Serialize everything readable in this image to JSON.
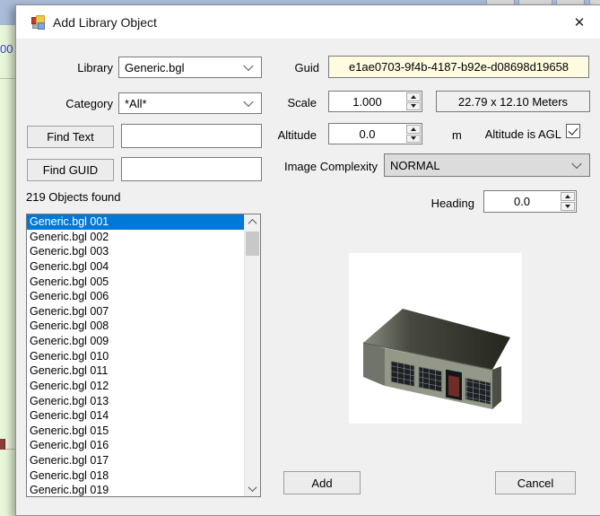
{
  "window": {
    "title": "Add Library Object",
    "close_glyph": "✕"
  },
  "background": {
    "partial_text": "00"
  },
  "colors": {
    "selection": "#0078d7",
    "guid_field_bg": "#fffbe1",
    "dialog_bg": "#f0f0f0",
    "titlebar_bg": "#ffffff",
    "top_strip": "#a9bcd9",
    "desktop_green": "#e8f7da"
  },
  "form": {
    "library_label": "Library",
    "library_value": "Generic.bgl",
    "category_label": "Category",
    "category_value": "*All*",
    "guid_label": "Guid",
    "guid_value": "e1ae0703-9f4b-4187-b92e-d08698d19658",
    "scale_label": "Scale",
    "scale_value": "1.000",
    "size_value": "22.79 x 12.10 Meters",
    "find_text_label": "Find Text",
    "find_text_value": "",
    "find_guid_label": "Find GUID",
    "find_guid_value": "",
    "altitude_label": "Altitude",
    "altitude_value": "0.0",
    "altitude_unit": "m",
    "agl_label": "Altitude is AGL",
    "agl_checked": true,
    "image_complexity_label": "Image Complexity",
    "image_complexity_value": "NORMAL",
    "heading_label": "Heading",
    "heading_value": "0.0",
    "objects_found": "219 Objects found",
    "add_label": "Add",
    "cancel_label": "Cancel"
  },
  "object_list": {
    "selected_index": 0,
    "items": [
      "Generic.bgl 001",
      "Generic.bgl 002",
      "Generic.bgl 003",
      "Generic.bgl 004",
      "Generic.bgl 005",
      "Generic.bgl 006",
      "Generic.bgl 007",
      "Generic.bgl 008",
      "Generic.bgl 009",
      "Generic.bgl 010",
      "Generic.bgl 011",
      "Generic.bgl 012",
      "Generic.bgl 013",
      "Generic.bgl 014",
      "Generic.bgl 015",
      "Generic.bgl 016",
      "Generic.bgl 017",
      "Generic.bgl 018",
      "Generic.bgl 019"
    ]
  }
}
